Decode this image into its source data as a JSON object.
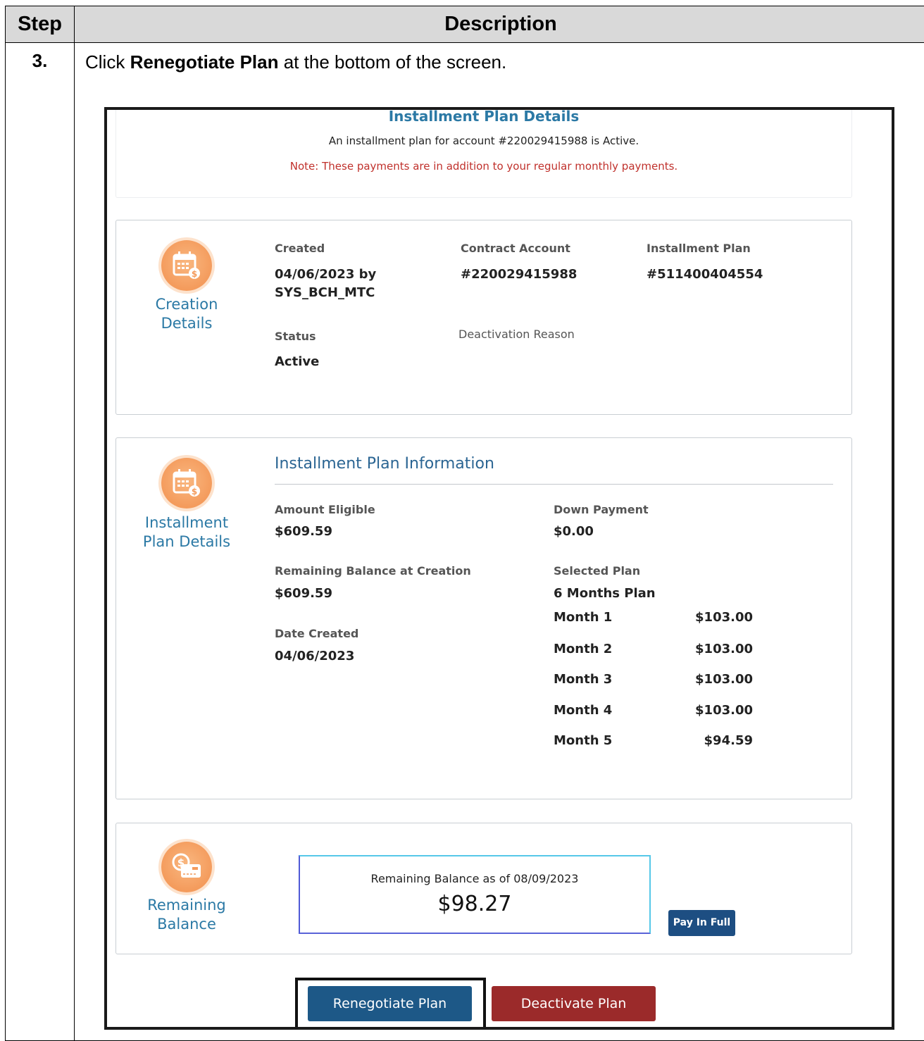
{
  "table": {
    "header_step": "Step",
    "header_description": "Description",
    "step_number": "3.",
    "instruction_prefix": "Click ",
    "instruction_bold": "Renegotiate Plan",
    "instruction_suffix": " at the bottom of the screen."
  },
  "screen": {
    "top": {
      "title": "Installment Plan Details",
      "subtitle": "An installment plan for account #220029415988 is Active.",
      "note": "Note: These payments are in addition to your regular monthly payments."
    },
    "creation": {
      "icon_label": "Creation Details",
      "created_label": "Created",
      "created_value_line1": "04/06/2023 by",
      "created_value_line2": "SYS_BCH_MTC",
      "contract_label": "Contract Account",
      "contract_value": "#220029415988",
      "plan_label": "Installment Plan",
      "plan_value": "#511400404554",
      "status_label": "Status",
      "status_value": "Active",
      "deactivation_label": "Deactivation Reason"
    },
    "info": {
      "icon_label": "Installment Plan Details",
      "section_title": "Installment Plan Information",
      "amount_eligible_label": "Amount Eligible",
      "amount_eligible_value": "$609.59",
      "down_payment_label": "Down Payment",
      "down_payment_value": "$0.00",
      "remaining_label": "Remaining Balance at Creation",
      "remaining_value": "$609.59",
      "selected_plan_label": "Selected Plan",
      "selected_plan_value": "6 Months Plan",
      "date_created_label": "Date Created",
      "date_created_value": "04/06/2023",
      "months": [
        {
          "label": "Month 1",
          "amount": "$103.00"
        },
        {
          "label": "Month 2",
          "amount": "$103.00"
        },
        {
          "label": "Month 3",
          "amount": "$103.00"
        },
        {
          "label": "Month 4",
          "amount": "$103.00"
        },
        {
          "label": "Month 5",
          "amount": "$94.59"
        }
      ]
    },
    "balance": {
      "icon_label": "Remaining Balance",
      "box_label": "Remaining Balance as of 08/09/2023",
      "box_value": "$98.27",
      "pay_in_full": "Pay In Full"
    },
    "buttons": {
      "renegotiate": "Renegotiate Plan",
      "deactivate": "Deactivate Plan"
    }
  }
}
